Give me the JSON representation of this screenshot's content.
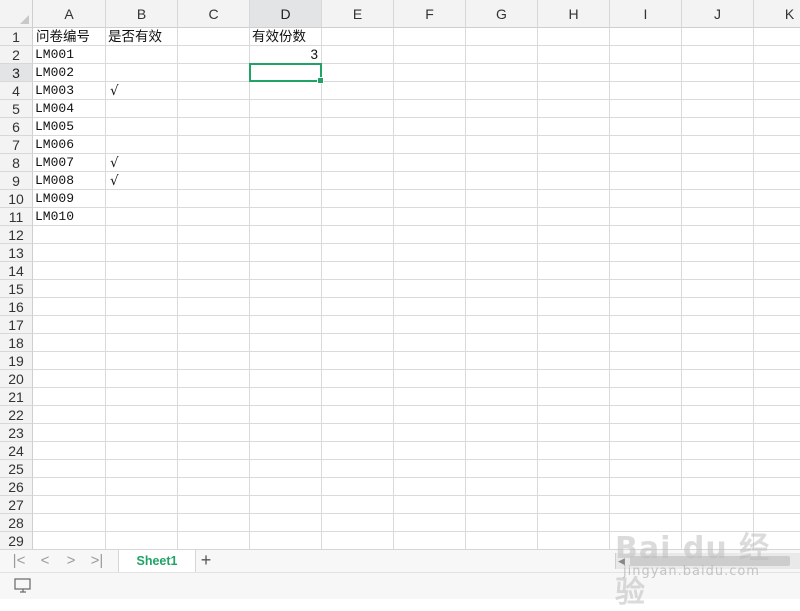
{
  "columns": [
    "A",
    "B",
    "C",
    "D",
    "E",
    "F",
    "G",
    "H",
    "I",
    "J",
    "K"
  ],
  "rows": [
    "1",
    "2",
    "3",
    "4",
    "5",
    "6",
    "7",
    "8",
    "9",
    "10",
    "11",
    "12",
    "13",
    "14",
    "15",
    "16",
    "17",
    "18",
    "19",
    "20",
    "21",
    "22",
    "23",
    "24",
    "25",
    "26",
    "27",
    "28",
    "29"
  ],
  "active_column": "D",
  "active_row": "3",
  "cells": {
    "A1": "问卷编号",
    "B1": "是否有效",
    "D1": "有效份数",
    "D2": "3",
    "A2": "LM001",
    "A3": "LM002",
    "A4": "LM003",
    "A5": "LM004",
    "A6": "LM005",
    "A7": "LM006",
    "A8": "LM007",
    "A9": "LM008",
    "A10": "LM009",
    "A11": "LM010",
    "B4": "√",
    "B8": "√",
    "B9": "√"
  },
  "sheet_tabs": [
    "Sheet1"
  ],
  "add_sheet_label": "+",
  "nav": {
    "first": "|<",
    "prev": "<",
    "next": ">",
    "last": ">|"
  },
  "watermark": {
    "brand": "Bai du 经验",
    "url": "jingyan.baidu.com"
  },
  "colors": {
    "accent": "#21a366",
    "header_bg": "#f3f3f3",
    "grid": "#dadada"
  }
}
